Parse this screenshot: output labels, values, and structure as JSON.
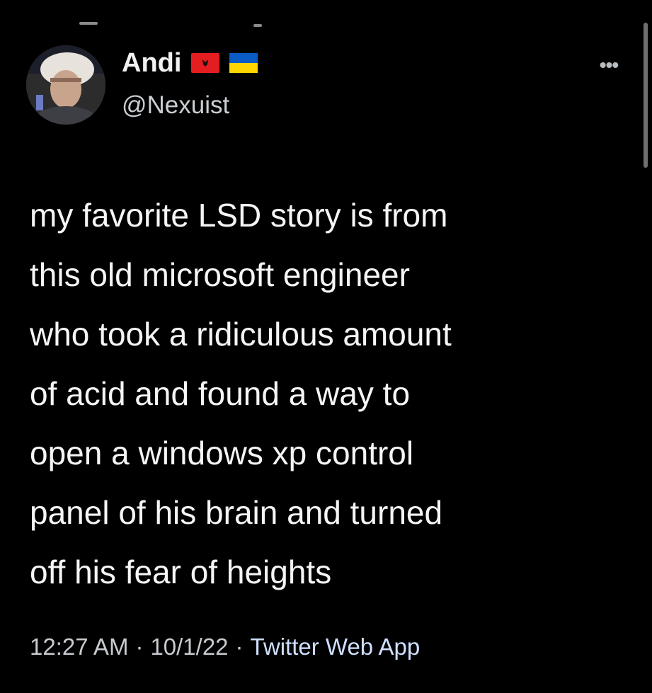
{
  "tweet": {
    "author": {
      "display_name": "Andi",
      "handle": "@Nexuist",
      "flags": [
        "albania-flag",
        "ukraine-flag"
      ]
    },
    "text": "my favorite LSD story is from\nthis old microsoft engineer\nwho took a ridiculous amount\nof acid and found a way to\nopen a windows xp control\npanel of his brain and turned\noff his fear of heights",
    "time": "12:27 AM",
    "date": "10/1/22",
    "separator": "·",
    "source": "Twitter Web App",
    "more_icon": "more-options-icon"
  },
  "colors": {
    "background": "#000000",
    "text": "#f5f5f5",
    "secondary_text": "#c7cbcf"
  }
}
